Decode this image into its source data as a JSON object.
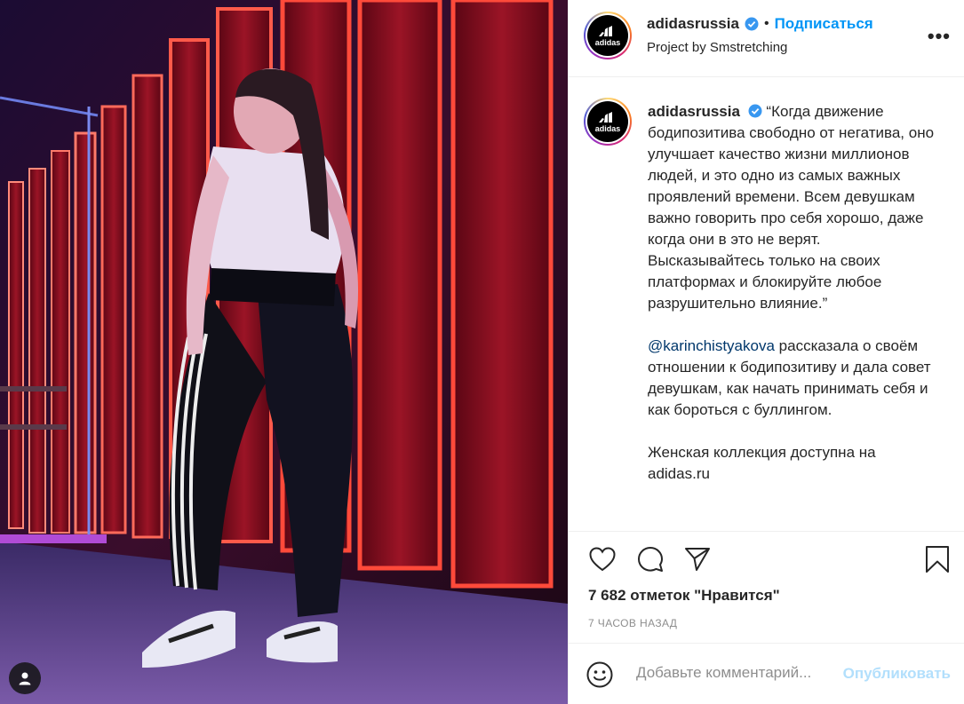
{
  "post": {
    "account": {
      "username": "adidasrussia",
      "verified": true,
      "avatar_text": "adidas",
      "location": "Project by Smstretching"
    },
    "follow_label": "Подписаться",
    "more_label": "•••",
    "caption": {
      "username": "adidasrussia",
      "paragraphs": [
        "“Когда движение бодипозитива свободно от негатива, оно улучшает качество жизни миллионов людей, и это одно из самых важных проявлений времени. Всем девушкам важно говорить про себя хорошо, даже когда они в это не верят. Высказывайтесь только на своих платформах и блокируйте любое разрушительно влияние.”",
        "рассказала о своём отношении к бодипозитиву и дала совет девушкам, как начать принимать себя и как бороться с буллингом.",
        "Женская коллекция доступна на adidas.ru"
      ],
      "mention": "@karinchistyakova"
    },
    "likes_text": "7 682 отметок \"Нравится\"",
    "time_text": "7 ЧАСОВ НАЗАД",
    "comment_placeholder": "Добавьте комментарий...",
    "publish_label": "Опубликовать"
  },
  "icons": {
    "like": "heart-icon",
    "comment": "comment-bubble-icon",
    "share": "paper-plane-icon",
    "save": "bookmark-icon",
    "emoji": "smiley-icon",
    "tags": "person-tag-icon"
  },
  "colors": {
    "link_blue": "#0095f6",
    "mention_blue": "#00376b",
    "muted": "#8e8e8e",
    "publish_disabled": "#b2dffc",
    "neon_red": "#ff3b3b"
  }
}
